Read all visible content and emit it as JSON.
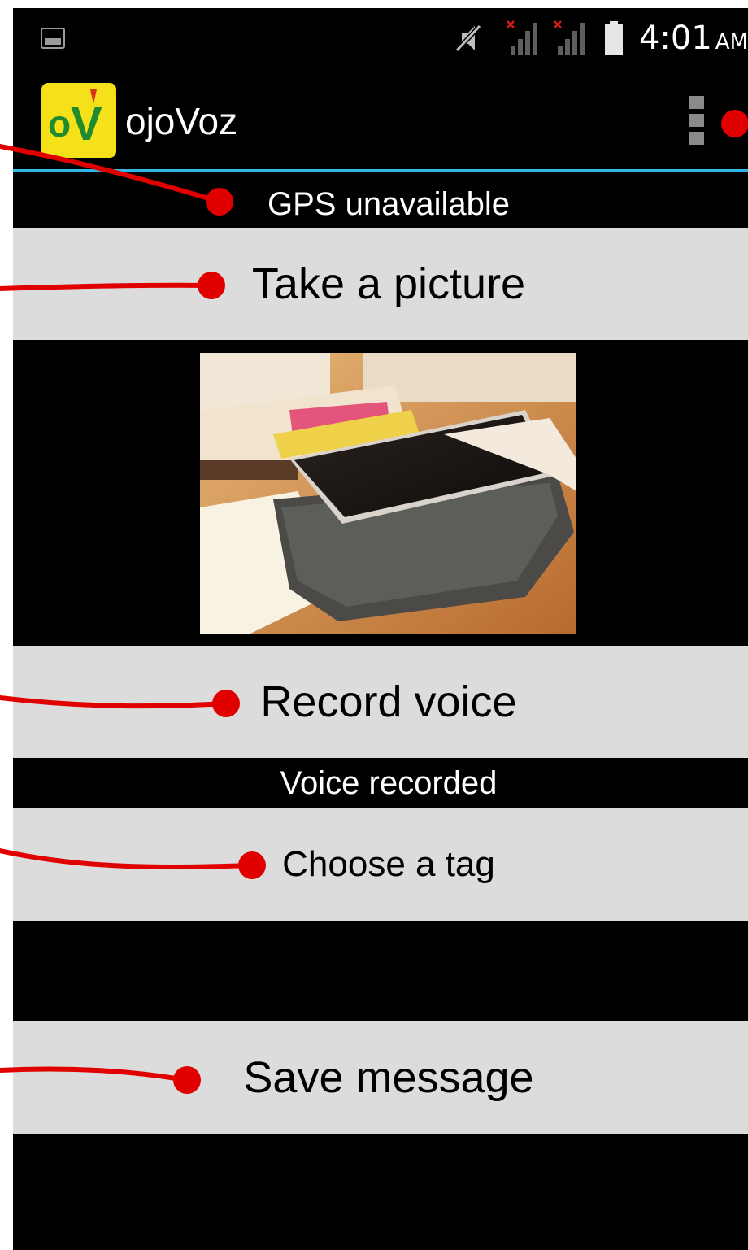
{
  "status_bar": {
    "time": "4:01",
    "ampm": "AM",
    "icons": [
      "gallery-icon",
      "mute-icon",
      "signal-icon",
      "signal-icon",
      "battery-icon"
    ]
  },
  "action_bar": {
    "app_logo_text": "oV",
    "app_title": "ojoVoz",
    "menu_icon": "overflow-menu-icon"
  },
  "main": {
    "gps_status": "GPS unavailable",
    "take_picture_label": "Take a picture",
    "record_voice_label": "Record voice",
    "voice_status": "Voice recorded",
    "choose_tag_label": "Choose a tag",
    "save_message_label": "Save message"
  },
  "colors": {
    "screen_background": "#000000",
    "button_background": "#dcdcdc",
    "action_bar_divider": "#33b5e5",
    "logo_background": "#f4e11a",
    "logo_green": "#1f8a2e",
    "annotation_red": "#e00000"
  }
}
